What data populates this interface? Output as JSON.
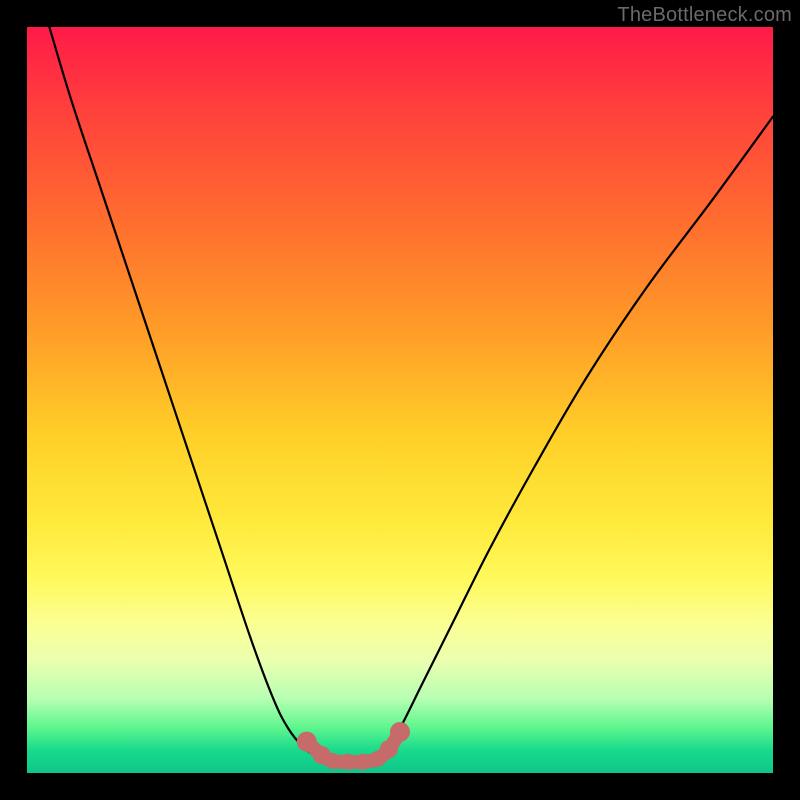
{
  "watermark": "TheBottleneck.com",
  "chart_data": {
    "type": "line",
    "title": "",
    "xlabel": "",
    "ylabel": "",
    "xlim": [
      0,
      100
    ],
    "ylim": [
      0,
      100
    ],
    "series": [
      {
        "name": "bottleneck-curve",
        "x": [
          3,
          6,
          10,
          14,
          18,
          22,
          26,
          30,
          33,
          35,
          37,
          39,
          40.5,
          42,
          44,
          46,
          48,
          50,
          53,
          57,
          62,
          68,
          75,
          83,
          92,
          100
        ],
        "y": [
          100,
          90,
          78,
          66,
          54,
          42,
          30,
          18,
          10,
          6,
          3.5,
          2,
          1.5,
          1.5,
          1.5,
          1.8,
          3,
          6,
          12,
          20,
          30,
          41,
          53,
          65,
          77,
          88
        ]
      }
    ],
    "markers": {
      "name": "trough-markers",
      "color": "#c76a6a",
      "x": [
        37.5,
        39.5,
        41,
        43,
        45,
        47,
        48.5,
        50
      ],
      "y": [
        4.2,
        2.4,
        1.6,
        1.5,
        1.5,
        1.9,
        3.2,
        5.5
      ],
      "radius_px": [
        10,
        9,
        8,
        8,
        8,
        8,
        9,
        10
      ]
    }
  }
}
